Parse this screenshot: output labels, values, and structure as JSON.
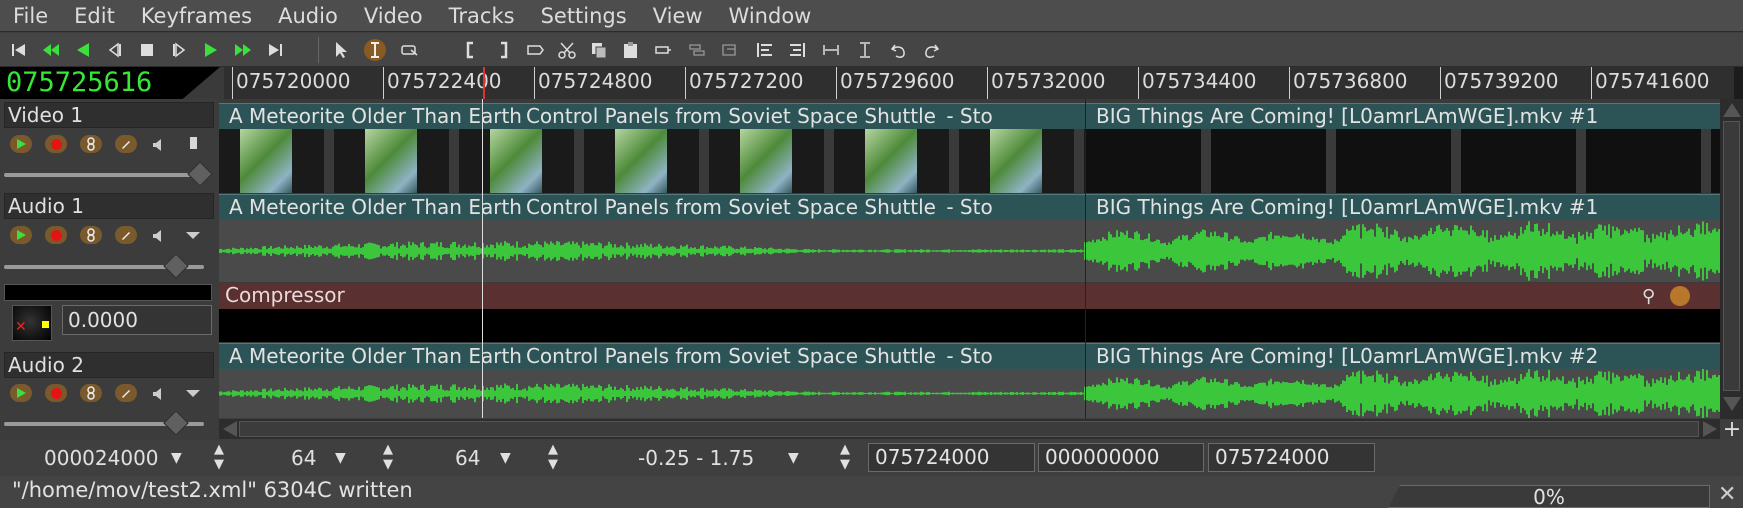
{
  "menu": [
    "File",
    "Edit",
    "Keyframes",
    "Audio",
    "Video",
    "Tracks",
    "Settings",
    "View",
    "Window"
  ],
  "clock": "075725616",
  "ruler_labels": [
    "075720000",
    "075722400",
    "075724800",
    "075727200",
    "075729600",
    "075732000",
    "075734400",
    "075736800",
    "075739200",
    "075741600"
  ],
  "tracks": {
    "video1": {
      "title": "Video 1"
    },
    "audio1": {
      "title": "Audio 1"
    },
    "audio2": {
      "title": "Audio 2"
    }
  },
  "plugin": {
    "title": "Compressor",
    "value": "0.0000"
  },
  "edits": {
    "first_label": "A Meteorite Older Than Earth",
    "second_label": "Control Panels from Soviet Space Shuttle",
    "third_label": " - Sto",
    "v1_right": "BIG Things Are Coming! [L0amrLAmWGE].mkv #1",
    "a1_right": "BIG Things Are Coming! [L0amrLAmWGE].mkv #1",
    "a2_right": "BIG Things Are Coming! [L0amrLAmWGE].mkv #2"
  },
  "bottom": {
    "zoom": "000024000",
    "samples": "64",
    "amp": "64",
    "range": "-0.25 - 1.75",
    "sel_start": "075724000",
    "sel_len": "000000000",
    "sel_end": "075724000"
  },
  "status": "\"/home/mov/test2.xml\" 6304C written",
  "progress": "0%",
  "colors": {
    "accent_green": "#38e638",
    "edit_header": "#2c5456",
    "plugin_header": "#5b3030"
  },
  "icons": [
    "rewind-to-start-icon",
    "fast-reverse-icon",
    "reverse-play-icon",
    "frame-reverse-icon",
    "stop-icon",
    "frame-forward-icon",
    "play-icon",
    "fast-forward-icon",
    "forward-to-end-icon",
    "arrow-cursor-icon",
    "ibeam-cursor-icon",
    "hand-drag-icon",
    "in-point-icon",
    "out-point-icon",
    "label-icon",
    "cut-icon",
    "copy-icon",
    "paste-icon",
    "overwrite-icon",
    "splice-icon",
    "to-clip-icon",
    "align-left-icon",
    "align-right-icon",
    "fit-width-icon",
    "fit-height-icon",
    "undo-icon",
    "redo-icon"
  ]
}
